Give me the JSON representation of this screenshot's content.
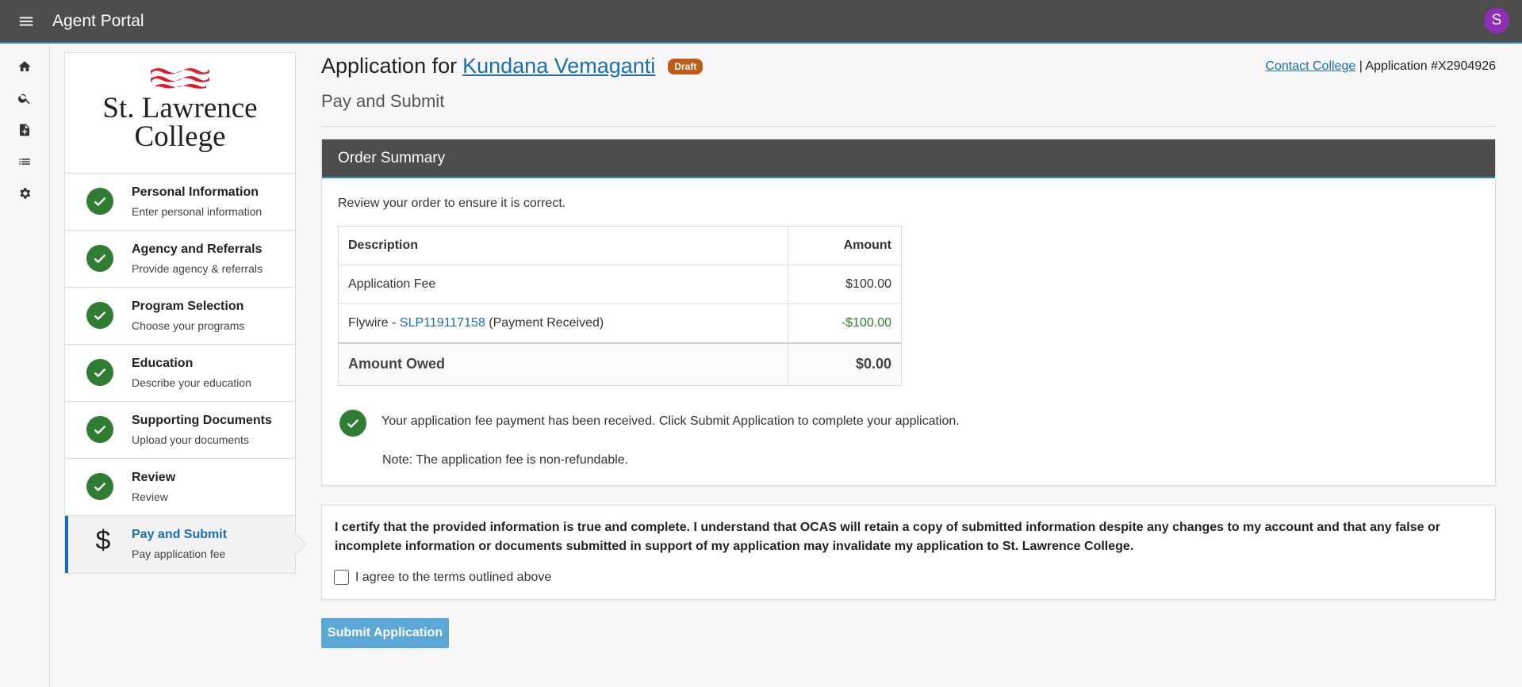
{
  "app": {
    "title": "Agent Portal",
    "avatar_initial": "S"
  },
  "rail": {
    "icons": [
      "home-icon",
      "search-icon",
      "add-document-icon",
      "list-icon",
      "gear-icon"
    ]
  },
  "college": {
    "logo_line1": "St. Lawrence",
    "logo_line2": "College"
  },
  "steps": [
    {
      "title": "Personal Information",
      "subtitle": "Enter personal information",
      "status": "complete"
    },
    {
      "title": "Agency and Referrals",
      "subtitle": "Provide agency & referrals",
      "status": "complete"
    },
    {
      "title": "Program Selection",
      "subtitle": "Choose your programs",
      "status": "complete"
    },
    {
      "title": "Education",
      "subtitle": "Describe your education",
      "status": "complete"
    },
    {
      "title": "Supporting Documents",
      "subtitle": "Upload your documents",
      "status": "complete"
    },
    {
      "title": "Review",
      "subtitle": "Review",
      "status": "complete"
    },
    {
      "title": "Pay and Submit",
      "subtitle": "Pay application fee",
      "status": "active",
      "icon": "$"
    }
  ],
  "header": {
    "prefix": "Application for",
    "applicant_name": "Kundana Vemaganti",
    "badge": "Draft",
    "contact_link": "Contact College",
    "separator": "|",
    "application_number": "Application #X2904926",
    "subtitle": "Pay and Submit"
  },
  "order": {
    "title": "Order Summary",
    "intro": "Review your order to ensure it is correct.",
    "columns": {
      "description": "Description",
      "amount": "Amount"
    },
    "fee_label": "Application Fee",
    "fee_amount": "$100.00",
    "payment_prefix": "Flywire - ",
    "payment_ref": "SLP119117158",
    "payment_suffix": " (Payment Received)",
    "payment_amount": "-$100.00",
    "owed_label": "Amount Owed",
    "owed_amount": "$0.00",
    "message": "Your application fee payment has been received. Click Submit Application to complete your application.",
    "note": "Note: The application fee is non-refundable."
  },
  "certification": {
    "text": "I certify that the provided information is true and complete. I understand that OCAS will retain a copy of submitted information despite any changes to my account and that any false or incomplete information or documents submitted in support of my application may invalidate my application to St. Lawrence College.",
    "checkbox_label": "I agree to the terms outlined above",
    "checked": false
  },
  "actions": {
    "submit_label": "Submit Application"
  },
  "colors": {
    "topbar": "#4d4d4d",
    "accent": "#2d8ab3",
    "link": "#1a6fb0",
    "success": "#2e7d32",
    "draft": "#c05a19",
    "avatar": "#8e2fb8",
    "submit": "#5ba8d8"
  }
}
